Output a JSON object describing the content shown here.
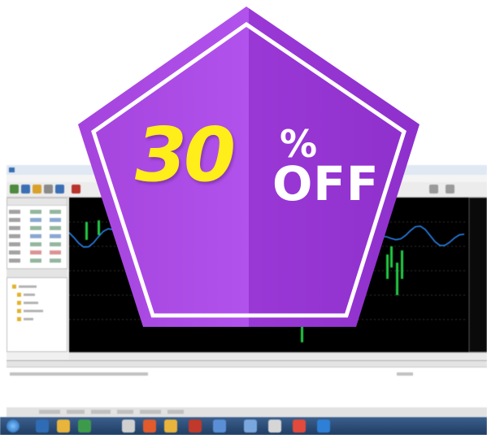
{
  "promo": {
    "discount_number": "30",
    "percent_symbol": "%",
    "off_label": "OFF",
    "colors": {
      "badge_fill": "#9b3dd6",
      "badge_fill_light": "#b453ea",
      "badge_border": "#ffffff",
      "number_color": "#ffee1a",
      "label_color": "#ffffff"
    }
  },
  "app_screenshot": {
    "chart_background": "#000000",
    "chart_line_color": "#2b8cff",
    "chart_candle_color": "#22cc44"
  },
  "icons": [
    "window-icon",
    "toolbar-icons",
    "folder-icon",
    "windows-start-icon"
  ]
}
